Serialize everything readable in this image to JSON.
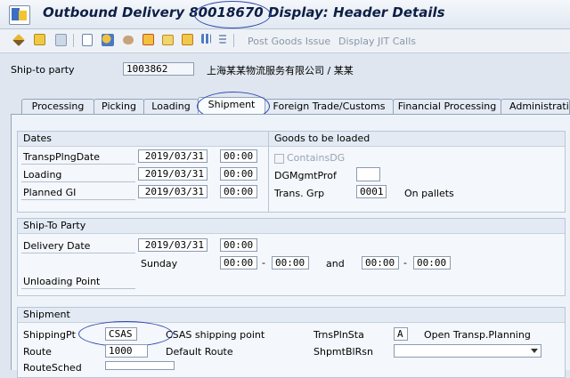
{
  "window": {
    "title_prefix": "Outbound Delivery",
    "delivery_number": "80018670",
    "title_suffix": "Display: Header Details"
  },
  "toolbar": {
    "post_goods_issue": "Post Goods Issue",
    "display_jit_calls": "Display JIT Calls",
    "icons": [
      "change-icon",
      "create-icon",
      "delete-icon",
      "document-flow-icon",
      "partner-icon",
      "print-icon",
      "texts-icon",
      "messages-icon",
      "status-icon",
      "grid-icon"
    ]
  },
  "header": {
    "ship_to_label": "Ship-to party",
    "ship_to_value": "1003862",
    "ship_to_name": "上海某某物流服务有限公司 / 某某"
  },
  "tabs": [
    "Processing",
    "Picking",
    "Loading",
    "Shipment",
    "Foreign Trade/Customs",
    "Financial Processing",
    "Administration"
  ],
  "active_tab": "Shipment",
  "dates": {
    "title": "Dates",
    "rows": [
      {
        "label": "TranspPlngDate",
        "date": "2019/03/31",
        "time": "00:00"
      },
      {
        "label": "Loading",
        "date": "2019/03/31",
        "time": "00:00"
      },
      {
        "label": "Planned GI",
        "date": "2019/03/31",
        "time": "00:00"
      }
    ]
  },
  "goods": {
    "title": "Goods to be loaded",
    "contains_dg": "ContainsDG",
    "dgmgmt_label": "DGMgmtProf",
    "dgmgmt_value": "",
    "trans_grp_label": "Trans. Grp",
    "trans_grp_value": "0001",
    "trans_grp_desc": "On pallets"
  },
  "shipto": {
    "title": "Ship-To Party",
    "delivery_date_label": "Delivery Date",
    "delivery_date": "2019/03/31",
    "delivery_time": "00:00",
    "weekday": "Sunday",
    "from1": "00:00",
    "to1": "00:00",
    "and": "and",
    "from2": "00:00",
    "to2": "00:00",
    "dash": "-",
    "unloading_label": "Unloading Point",
    "unloading_value": ""
  },
  "shipment": {
    "title": "Shipment",
    "shipping_pt_label": "ShippingPt",
    "shipping_pt_value": "CSAS",
    "shipping_pt_desc": "CSAS shipping point",
    "route_label": "Route",
    "route_value": "1000",
    "route_desc": "Default Route",
    "route_sched_label": "RouteSched",
    "route_sched_value": "",
    "trnspln_label": "TrnsPlnSta",
    "trnspln_value": "A",
    "trnspln_desc": "Open Transp.Planning",
    "shpmt_label": "ShpmtBlRsn",
    "shpmt_value": ""
  },
  "colors": {
    "title_text": "#0d1f45",
    "highlight_circle": "#2f48b0",
    "panel_bg": "#eef3f9"
  }
}
